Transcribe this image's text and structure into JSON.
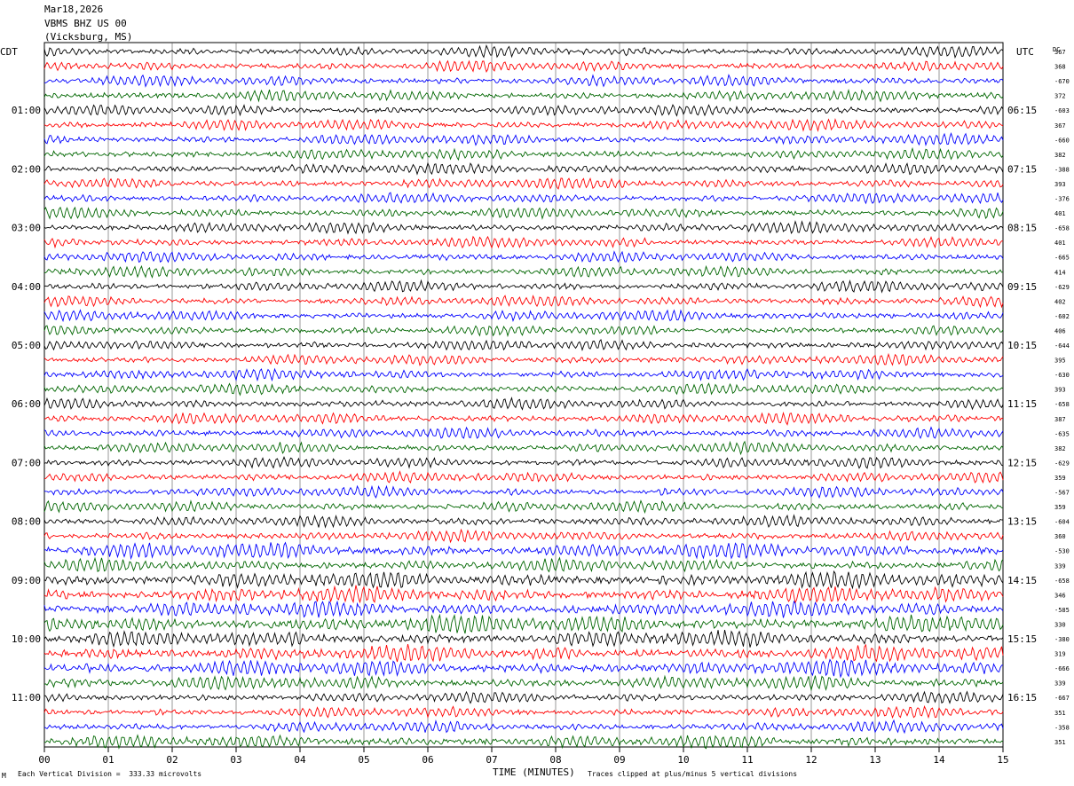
{
  "header": {
    "date": "Mar18,2026",
    "station": "VBMS BHZ US 00",
    "location": "(Vicksburg, MS)"
  },
  "left_zone": "CDT",
  "right_zone": "UTC",
  "dc_label": "DC",
  "footer": {
    "scale": "Each Vertical Division =  333.33 microvolts",
    "clip": "Traces clipped at plus/minus 5 vertical divisions",
    "corner": "M"
  },
  "chart_data": {
    "type": "line",
    "title": "",
    "xlabel": "TIME (MINUTES)",
    "ylabel": "",
    "xlim": [
      0,
      15
    ],
    "x_ticks": [
      "00",
      "01",
      "02",
      "03",
      "04",
      "05",
      "06",
      "07",
      "08",
      "09",
      "10",
      "11",
      "12",
      "13",
      "14",
      "15"
    ],
    "grid": true,
    "trace_minutes": 15,
    "trace_colors": [
      "#000000",
      "#ff0000",
      "#0000ff",
      "#006600"
    ],
    "left_hour_labels": [
      "01:00",
      "02:00",
      "03:00",
      "04:00",
      "05:00",
      "06:00",
      "07:00",
      "08:00",
      "09:00",
      "10:00",
      "11:00"
    ],
    "right_hour_labels": [
      "06:15",
      "07:15",
      "08:15",
      "09:15",
      "10:15",
      "11:15",
      "12:15",
      "13:15",
      "14:15",
      "15:15",
      "16:15"
    ],
    "hour_label_rows": [
      4,
      8,
      12,
      16,
      20,
      24,
      28,
      32,
      36,
      40,
      44
    ],
    "dc_offsets": [
      "367",
      "368",
      "-670",
      "372",
      "-603",
      "367",
      "-660",
      "382",
      "-388",
      "393",
      "-376",
      "401",
      "-658",
      "401",
      "-665",
      "414",
      "-629",
      "402",
      "-602",
      "406",
      "-644",
      "395",
      "-630",
      "393",
      "-658",
      "387",
      "-635",
      "382",
      "-629",
      "359",
      "-567",
      "359",
      "-604",
      "360",
      "-530",
      "339",
      "-658",
      "346",
      "-585",
      "330",
      "-380",
      "319",
      "-666",
      "339",
      "-667",
      "351",
      "-358",
      "351"
    ],
    "trace_amplitude": [
      4,
      4,
      4,
      4,
      4,
      4,
      4,
      4,
      4,
      4,
      4,
      4,
      4,
      4,
      4,
      4,
      4,
      4,
      4,
      4,
      4,
      4,
      4,
      4,
      4,
      4,
      4,
      4,
      4,
      4,
      4,
      4,
      4,
      4,
      6,
      5,
      6,
      6,
      6,
      7,
      6,
      6,
      6,
      5,
      4,
      4,
      4,
      5
    ]
  }
}
